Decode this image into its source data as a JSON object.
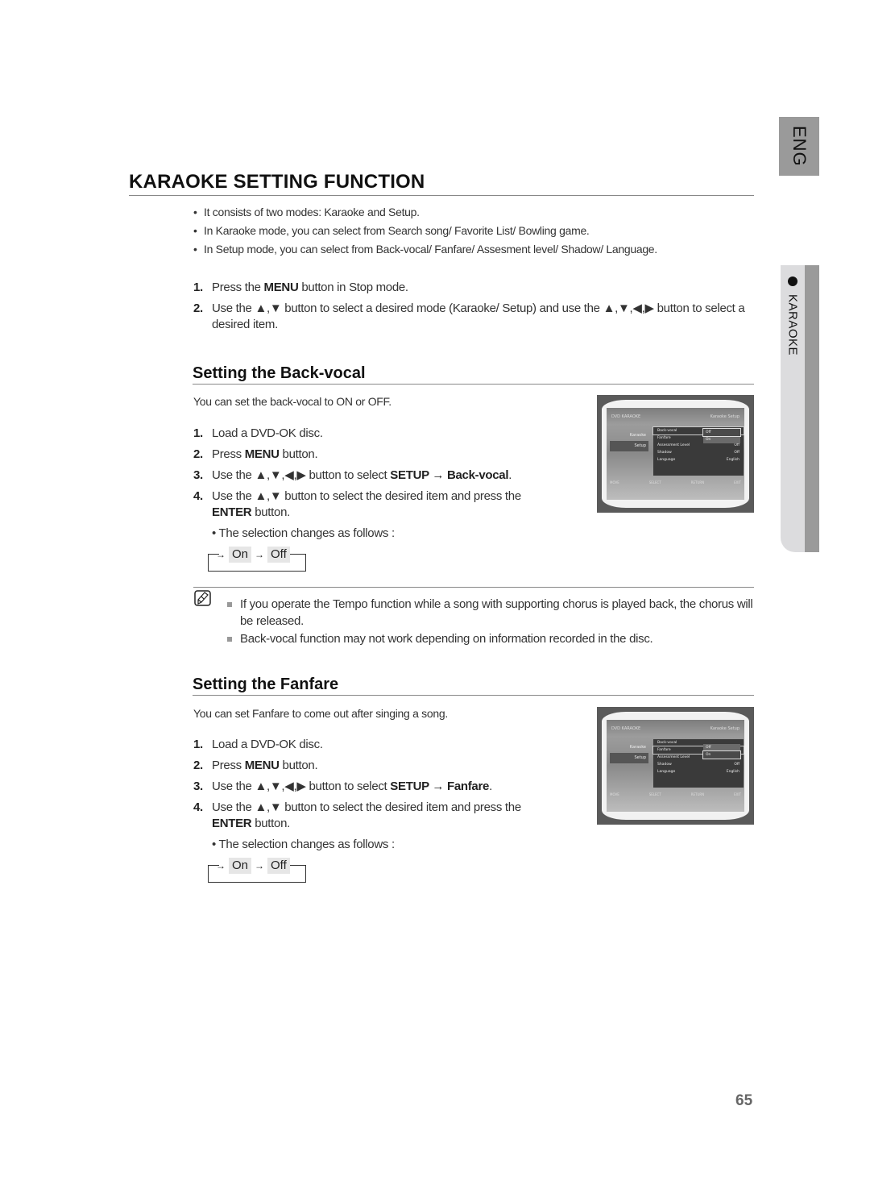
{
  "side_tabs": {
    "language": "ENG",
    "section": "KARAOKE"
  },
  "title": "KARAOKE SETTING FUNCTION",
  "intro_bullets": [
    "It consists of two modes: Karaoke and Setup.",
    "In Karaoke mode, you can select from Search song/ Favorite List/ Bowling game.",
    "In Setup mode, you can select from Back-vocal/ Fanfare/ Assesment level/ Shadow/ Language."
  ],
  "intro_steps": [
    {
      "num": "1.",
      "pre": "Press the ",
      "bold": "MENU",
      "post": " button in Stop mode."
    },
    {
      "num": "2.",
      "text": "Use the ▲,▼ button to select a desired mode (Karaoke/ Setup) and use the ▲,▼,◀,▶ button to select a desired item."
    }
  ],
  "sections": [
    {
      "title": "Setting the Back-vocal",
      "description": "You can set the back-vocal to ON or OFF.",
      "steps": [
        {
          "num": "1.",
          "text": "Load a DVD-OK disc."
        },
        {
          "num": "2.",
          "pre": "Press ",
          "bold": "MENU",
          "post": " button."
        },
        {
          "num": "3.",
          "pre": "Use the ▲,▼,◀,▶ button to select ",
          "bold": "SETUP → Back-vocal",
          "post": "."
        },
        {
          "num": "4.",
          "pre": "Use the ▲,▼ button to select the desired item and press the ",
          "bold": "ENTER",
          "post": " button."
        }
      ],
      "sub_bullet": "• The selection changes as follows :",
      "flow": {
        "a": "On",
        "b": "Off",
        "arrow": "→"
      },
      "screen": {
        "header_left": "DVD KARAOKE",
        "header_right": "Karaoke Setup",
        "left_menu": [
          "Karaoke",
          "Setup"
        ],
        "items": [
          {
            "label": "Back-vocal",
            "value": "Off"
          },
          {
            "label": "Fanfare",
            "value": ""
          },
          {
            "label": "Assessment Level",
            "value": "Off"
          },
          {
            "label": "Shadow",
            "value": "Off"
          },
          {
            "label": "Language",
            "value": "English"
          }
        ],
        "dropdown": [
          "Off",
          "On"
        ],
        "footer": [
          "MOVE",
          "SELECT",
          "RETURN",
          "EXIT"
        ]
      }
    },
    {
      "title": "Setting the Fanfare",
      "description": "You can set Fanfare to come out after singing a song.",
      "steps": [
        {
          "num": "1.",
          "text": "Load a DVD-OK disc."
        },
        {
          "num": "2.",
          "pre": "Press ",
          "bold": "MENU",
          "post": " button."
        },
        {
          "num": "3.",
          "pre": "Use the ▲,▼,◀,▶ button to select ",
          "bold": "SETUP → Fanfare",
          "post": "."
        },
        {
          "num": "4.",
          "pre": "Use the ▲,▼ button to select the desired item and press the ",
          "bold": "ENTER",
          "post": " button."
        }
      ],
      "sub_bullet": "• The selection changes as follows :",
      "flow": {
        "a": "On",
        "b": "Off",
        "arrow": "→"
      },
      "screen": {
        "header_left": "DVD KARAOKE",
        "header_right": "Karaoke Setup",
        "left_menu": [
          "Karaoke",
          "Setup"
        ],
        "items": [
          {
            "label": "Back-vocal",
            "value": ""
          },
          {
            "label": "Fanfare",
            "value": ""
          },
          {
            "label": "Assessment Level",
            "value": ""
          },
          {
            "label": "Shadow",
            "value": "Off"
          },
          {
            "label": "Language",
            "value": "English"
          }
        ],
        "dropdown": [
          "Off",
          "On"
        ],
        "footer": [
          "MOVE",
          "SELECT",
          "RETURN",
          "EXIT"
        ]
      }
    }
  ],
  "notes": [
    "If you operate the Tempo function while a song with supporting chorus is played back, the chorus will be released.",
    "Back-vocal function may not work depending on information recorded in the disc."
  ],
  "page_number": "65"
}
